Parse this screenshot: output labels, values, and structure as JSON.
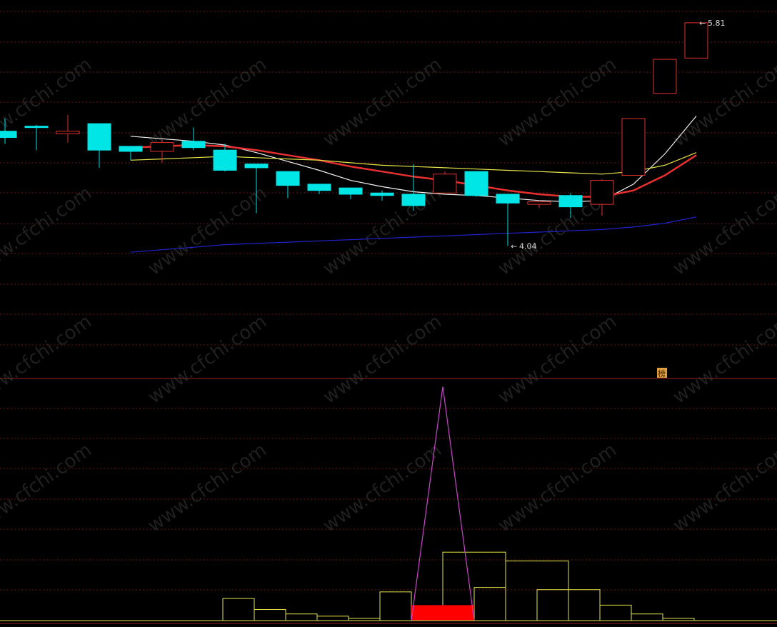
{
  "chart_data": [
    {
      "type": "candlestick",
      "panel": "price",
      "title": "",
      "y_range": [
        3.0,
        5.9
      ],
      "grid": "dotted-horizontal",
      "candles": [
        {
          "open": 4.95,
          "high": 5.05,
          "low": 4.85,
          "close": 4.9
        },
        {
          "open": 4.99,
          "high": 5.0,
          "low": 4.8,
          "close": 4.98
        },
        {
          "open": 4.93,
          "high": 5.08,
          "low": 4.86,
          "close": 4.95
        },
        {
          "open": 5.01,
          "high": 5.01,
          "low": 4.66,
          "close": 4.8
        },
        {
          "open": 4.83,
          "high": 4.83,
          "low": 4.72,
          "close": 4.79
        },
        {
          "open": 4.79,
          "high": 4.88,
          "low": 4.7,
          "close": 4.86
        },
        {
          "open": 4.87,
          "high": 4.98,
          "low": 4.8,
          "close": 4.82
        },
        {
          "open": 4.8,
          "high": 4.85,
          "low": 4.63,
          "close": 4.64
        },
        {
          "open": 4.69,
          "high": 4.69,
          "low": 4.3,
          "close": 4.66
        },
        {
          "open": 4.63,
          "high": 4.63,
          "low": 4.42,
          "close": 4.52
        },
        {
          "open": 4.53,
          "high": 4.53,
          "low": 4.45,
          "close": 4.48
        },
        {
          "open": 4.5,
          "high": 4.5,
          "low": 4.41,
          "close": 4.45
        },
        {
          "open": 4.46,
          "high": 4.48,
          "low": 4.4,
          "close": 4.44
        },
        {
          "open": 4.45,
          "high": 4.69,
          "low": 4.32,
          "close": 4.36
        },
        {
          "open": 4.46,
          "high": 4.63,
          "low": 4.46,
          "close": 4.61
        },
        {
          "open": 4.63,
          "high": 4.63,
          "low": 4.43,
          "close": 4.44
        },
        {
          "open": 4.45,
          "high": 4.45,
          "low": 4.04,
          "close": 4.38
        },
        {
          "open": 4.37,
          "high": 4.39,
          "low": 4.34,
          "close": 4.39
        },
        {
          "open": 4.44,
          "high": 4.46,
          "low": 4.26,
          "close": 4.35
        },
        {
          "open": 4.37,
          "high": 4.57,
          "low": 4.28,
          "close": 4.56
        },
        {
          "open": 4.6,
          "high": 5.05,
          "low": 4.6,
          "close": 5.05
        },
        {
          "open": 5.25,
          "high": 5.52,
          "low": 5.25,
          "close": 5.52
        },
        {
          "open": 5.53,
          "high": 5.81,
          "low": 5.53,
          "close": 5.81
        }
      ],
      "ma_lines": [
        {
          "color": "#f2f2f2",
          "values": [
            null,
            null,
            null,
            null,
            4.91,
            4.89,
            4.87,
            4.84,
            4.78,
            4.71,
            4.64,
            4.56,
            4.51,
            4.47,
            4.45,
            4.44,
            4.42,
            4.4,
            4.39,
            4.4,
            4.53,
            4.77,
            5.07
          ]
        },
        {
          "color": "#e83030",
          "values": [
            null,
            null,
            null,
            null,
            4.82,
            4.83,
            4.84,
            4.83,
            4.8,
            4.76,
            4.72,
            4.67,
            4.63,
            4.59,
            4.56,
            4.52,
            4.48,
            4.45,
            4.43,
            4.43,
            4.48,
            4.6,
            4.76
          ]
        },
        {
          "color": "#e6e64a",
          "values": [
            null,
            null,
            null,
            null,
            4.72,
            4.73,
            4.74,
            4.75,
            4.74,
            4.73,
            4.72,
            4.7,
            4.68,
            4.67,
            4.66,
            4.65,
            4.64,
            4.63,
            4.62,
            4.61,
            4.63,
            4.68,
            4.78
          ]
        },
        {
          "color": "#2222cc",
          "values": [
            null,
            null,
            null,
            null,
            3.99,
            4.01,
            4.03,
            4.05,
            4.06,
            4.07,
            4.08,
            4.09,
            4.1,
            4.11,
            4.12,
            4.13,
            4.14,
            4.15,
            4.16,
            4.17,
            4.19,
            4.22,
            4.27
          ]
        }
      ],
      "annotations": [
        {
          "text": "5.81",
          "candle": 22,
          "at": "high"
        },
        {
          "text": "4.04",
          "candle": 16,
          "at": "low"
        }
      ],
      "badge_text": "榜"
    },
    {
      "type": "bar",
      "panel": "indicator",
      "title": "",
      "y_range": [
        0,
        100
      ],
      "outline_color": "#e6e64a",
      "bars": [
        {
          "start": 7,
          "end": 8,
          "value": 10
        },
        {
          "start": 8,
          "end": 9,
          "value": 5
        },
        {
          "start": 9,
          "end": 10,
          "value": 3
        },
        {
          "start": 10,
          "end": 11,
          "value": 2
        },
        {
          "start": 11,
          "end": 12,
          "value": 1
        },
        {
          "start": 12,
          "end": 13,
          "value": 13
        },
        {
          "start": 14,
          "end": 16,
          "value": 31
        },
        {
          "start": 15,
          "end": 16,
          "value": 15
        },
        {
          "start": 16,
          "end": 18,
          "value": 27
        },
        {
          "start": 17,
          "end": 19,
          "value": 14
        },
        {
          "start": 19,
          "end": 20,
          "value": 7
        },
        {
          "start": 20,
          "end": 21,
          "value": 3
        },
        {
          "start": 21,
          "end": 22,
          "value": 1
        }
      ],
      "highlight": {
        "start": 13,
        "end": 15,
        "value": 7,
        "color": "#ff0000"
      },
      "spike": {
        "from": 13,
        "peak": 14,
        "to": 15,
        "value": 106,
        "color": "#cc44cc"
      }
    }
  ],
  "watermark": "www.cfchi.com",
  "colors": {
    "up": "#e03030",
    "down": "#00e5e5",
    "grid": "#6a1515",
    "divider": "#9a2222",
    "background": "#000000"
  }
}
